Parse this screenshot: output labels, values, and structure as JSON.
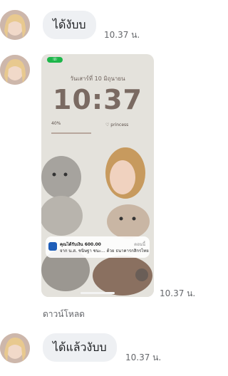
{
  "messages": [
    {
      "text": "ได้งับบ",
      "time": "10.37 น."
    },
    {
      "time": "10.37 น."
    },
    {
      "text": "ได้แล้วงับบ",
      "time": "10.37 น."
    }
  ],
  "download_label": "ดาวน์โหลด",
  "lockscreen": {
    "date": "วันเสาร์ที่ 10 มิถุนายน",
    "clock": "10:37",
    "widget_left": "40%",
    "widget_right": "princess",
    "notification_title": "คุณได้รับเงิน 600.00",
    "notification_body": "จาก น.ส. ชนิษฐา ชนะ... ด้วย ธนาคารกสิกรไทย",
    "notification_time": "ตอนนี้"
  },
  "icons": [
    "avatar",
    "camera-icon",
    "bank-logo-icon"
  ]
}
